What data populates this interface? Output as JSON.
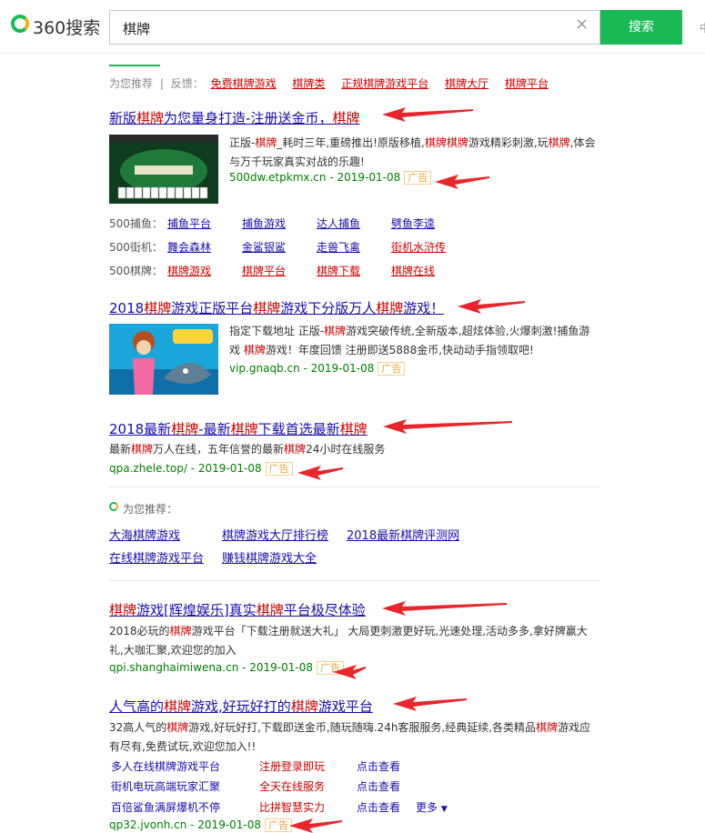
{
  "header": {
    "logo_text": "360搜索",
    "query": "棋牌",
    "clear_glyph": "×",
    "search_button": "搜索"
  },
  "recommend": {
    "prefix": "为您推荐",
    "feedback": "反馈：",
    "items": [
      "免费棋牌游戏",
      "棋牌类",
      "正规棋牌游戏平台",
      "棋牌大厅",
      "棋牌平台"
    ]
  },
  "results": [
    {
      "title": [
        "新版",
        "棋牌",
        "为您量身打造-注册送金币，",
        "棋牌"
      ],
      "desc": [
        "正版-",
        "棋牌",
        "_耗时三年,重磅推出!原版移植,",
        "棋牌棋牌",
        "游戏精彩刺激,玩",
        "棋牌",
        ",体会与万千玩家真实对战的乐趣!"
      ],
      "url": "500dw.etpkmx.cn - 2019-01-08",
      "ad": "广告",
      "sublinks": [
        {
          "label": "500捕鱼：",
          "links": [
            "捕鱼平台",
            "捕鱼游戏",
            "达人捕鱼",
            "劈鱼李逵"
          ]
        },
        {
          "label": "500街机：",
          "links": [
            "舞会森林",
            "金鲨银鲨",
            "走兽飞禽",
            "街机水浒传"
          ]
        },
        {
          "label": "500棋牌：",
          "links": [
            "棋牌游戏",
            "棋牌平台",
            "棋牌下载",
            "棋牌在线"
          ]
        }
      ]
    },
    {
      "title": [
        "2018",
        "棋牌",
        "游戏正版平台",
        "棋牌",
        "游戏下分版万人",
        "棋牌",
        "游戏！"
      ],
      "desc": [
        "指定下载地址 正版-",
        "棋牌",
        "游戏突破传统,全新版本,超炫体验,火爆刺激!捕鱼游戏 ",
        "棋牌",
        "游戏！年度回馈 注册即送5888金币,快动动手指领取吧!"
      ],
      "url": "vip.gnaqb.cn - 2019-01-08",
      "ad": "广告"
    },
    {
      "title": [
        "2018最新",
        "棋牌",
        "-最新",
        "棋牌",
        "下载首选最新",
        "棋牌"
      ],
      "desc": [
        "最新",
        "棋牌",
        "万人在线，五年信誉的最新",
        "棋牌",
        "24小时在线服务"
      ],
      "url": "qpa.zhele.top/ - 2019-01-08",
      "ad": "广告"
    }
  ],
  "recommend2": {
    "title": "为您推荐：",
    "items": [
      "大海棋牌游戏",
      "棋牌游戏大厅排行榜",
      "2018最新棋牌评测网",
      "在线棋牌游戏平台",
      "赚钱棋牌游戏大全"
    ]
  },
  "results2": [
    {
      "title": [
        "棋牌",
        "游戏[辉煌娱乐]真实",
        "棋牌",
        "平台极尽体验"
      ],
      "desc": [
        "2018必玩的",
        "棋牌",
        "游戏平台「下载注册就送大礼」 大局更刺激更好玩,光速处理,活动多多,拿好牌赢大礼,大咖汇聚,欢迎您的加入"
      ],
      "url": "qpi.shanghaimiwena.cn - 2019-01-08",
      "ad": "广告"
    },
    {
      "title": [
        "人气高的",
        "棋牌",
        "游戏,好玩好打的",
        "棋牌",
        "游戏平台"
      ],
      "desc": [
        "32高人气的",
        "棋牌",
        "游戏,好玩好打,下载即送金币,随玩随嗨.24h客服服务,经典延续,各类精品",
        "棋牌",
        "游戏应有尽有,免费试玩,欢迎您加入!!"
      ],
      "links": [
        [
          "多人在线棋牌游戏平台",
          "注册登录即玩",
          "点击查看"
        ],
        [
          "街机电玩高端玩家汇聚",
          "全天在线服务",
          "点击查看"
        ],
        [
          "百倍鲨鱼满屏爆机不停",
          "比拼智慧实力",
          "点击查看"
        ]
      ],
      "more": "更多",
      "url": "qp32.jvonh.cn - 2019-01-08",
      "ad": "广告"
    }
  ],
  "colors": {
    "brand": "#19b955",
    "link": "#1a0dab",
    "highlight": "#cc0000",
    "url": "#008000",
    "arrow": "#e8252a"
  }
}
